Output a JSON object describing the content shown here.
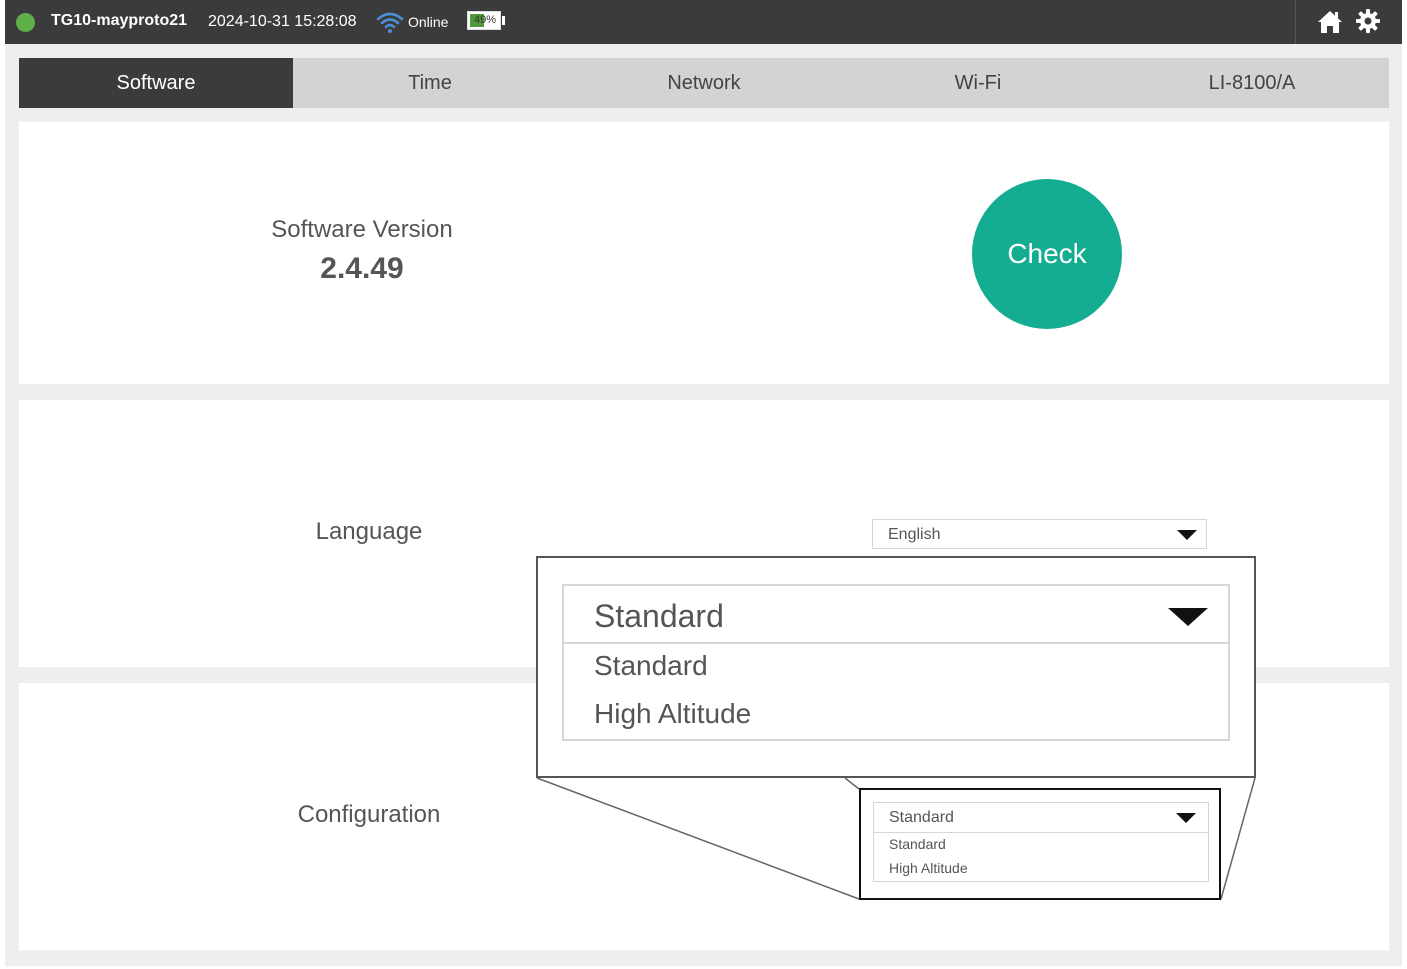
{
  "topbar": {
    "device_name": "TG10-mayproto21",
    "datetime": "2024-10-31 15:28:08",
    "connection_status": "Online",
    "battery_text": "49%",
    "battery_level_percent": 49,
    "status_color": "#5fb04a",
    "icons": [
      "wifi-icon",
      "home-icon",
      "gear-icon"
    ]
  },
  "tabs": [
    {
      "label": "Software",
      "active": true
    },
    {
      "label": "Time",
      "active": false
    },
    {
      "label": "Network",
      "active": false
    },
    {
      "label": "Wi-Fi",
      "active": false
    },
    {
      "label": "LI-8100/A",
      "active": false
    }
  ],
  "software": {
    "version_label": "Software Version",
    "version_value": "2.4.49",
    "check_label": "Check",
    "accent_color": "#14ad91"
  },
  "language": {
    "label": "Language",
    "selected": "English"
  },
  "configuration": {
    "label": "Configuration",
    "selected": "Standard",
    "options": [
      "Standard",
      "High Altitude"
    ]
  }
}
